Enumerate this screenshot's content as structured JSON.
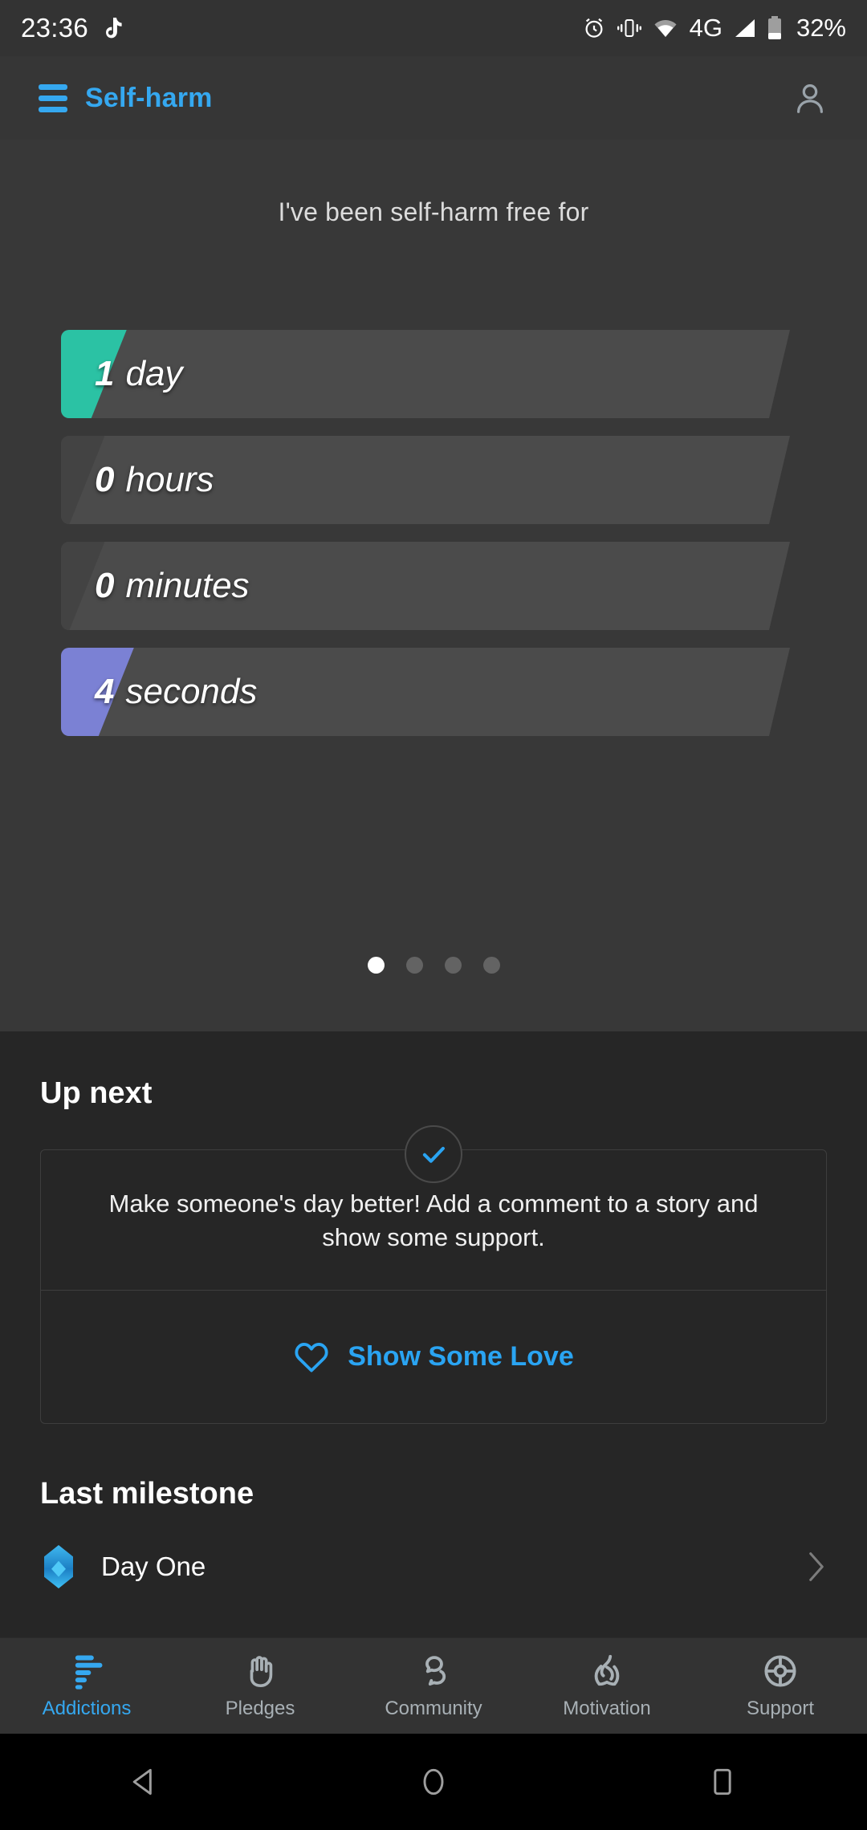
{
  "status_bar": {
    "time": "23:36",
    "battery_percent": "32%",
    "network": "4G",
    "icons": [
      "tiktok-icon",
      "alarm-icon",
      "vibrate-icon",
      "wifi-icon",
      "network-4g-label",
      "signal-icon",
      "battery-icon"
    ]
  },
  "app_bar": {
    "menu_icon": "hamburger-menu-icon",
    "title": "Self-harm",
    "account_icon": "account-icon",
    "accent_color": "#35A8F0"
  },
  "counter": {
    "subtitle": "I've been self-harm free for",
    "rows": [
      {
        "value": "1",
        "unit": "day",
        "fill_color": "#2BC2A4",
        "fill_percent": 7
      },
      {
        "value": "0",
        "unit": "hours",
        "fill_color": "#424242",
        "fill_percent": 4
      },
      {
        "value": "0",
        "unit": "minutes",
        "fill_color": "#424242",
        "fill_percent": 4
      },
      {
        "value": "4",
        "unit": "seconds",
        "fill_color": "#7B81D4",
        "fill_percent": 8
      }
    ],
    "pager": {
      "total": 4,
      "active_index": 0
    }
  },
  "up_next": {
    "heading": "Up next",
    "check_icon": "check-circle-icon",
    "body": "Make someone's day better! Add a comment to a story and show some support.",
    "action_icon": "heart-icon",
    "action_label": "Show Some Love",
    "action_color": "#2AA4F2"
  },
  "last_milestone": {
    "heading": "Last milestone",
    "badge_icon": "milestone-badge-icon",
    "name": "Day One",
    "chevron_icon": "chevron-right-icon"
  },
  "bottom_nav": {
    "items": [
      {
        "label": "Addictions",
        "icon": "bars-icon",
        "active": true
      },
      {
        "label": "Pledges",
        "icon": "hand-icon",
        "active": false
      },
      {
        "label": "Community",
        "icon": "speech-bubbles-icon",
        "active": false
      },
      {
        "label": "Motivation",
        "icon": "flame-icon",
        "active": false
      },
      {
        "label": "Support",
        "icon": "life-ring-icon",
        "active": false
      }
    ]
  },
  "android_nav": {
    "back": "back-triangle-icon",
    "home": "home-circle-icon",
    "recents": "recents-square-icon"
  }
}
